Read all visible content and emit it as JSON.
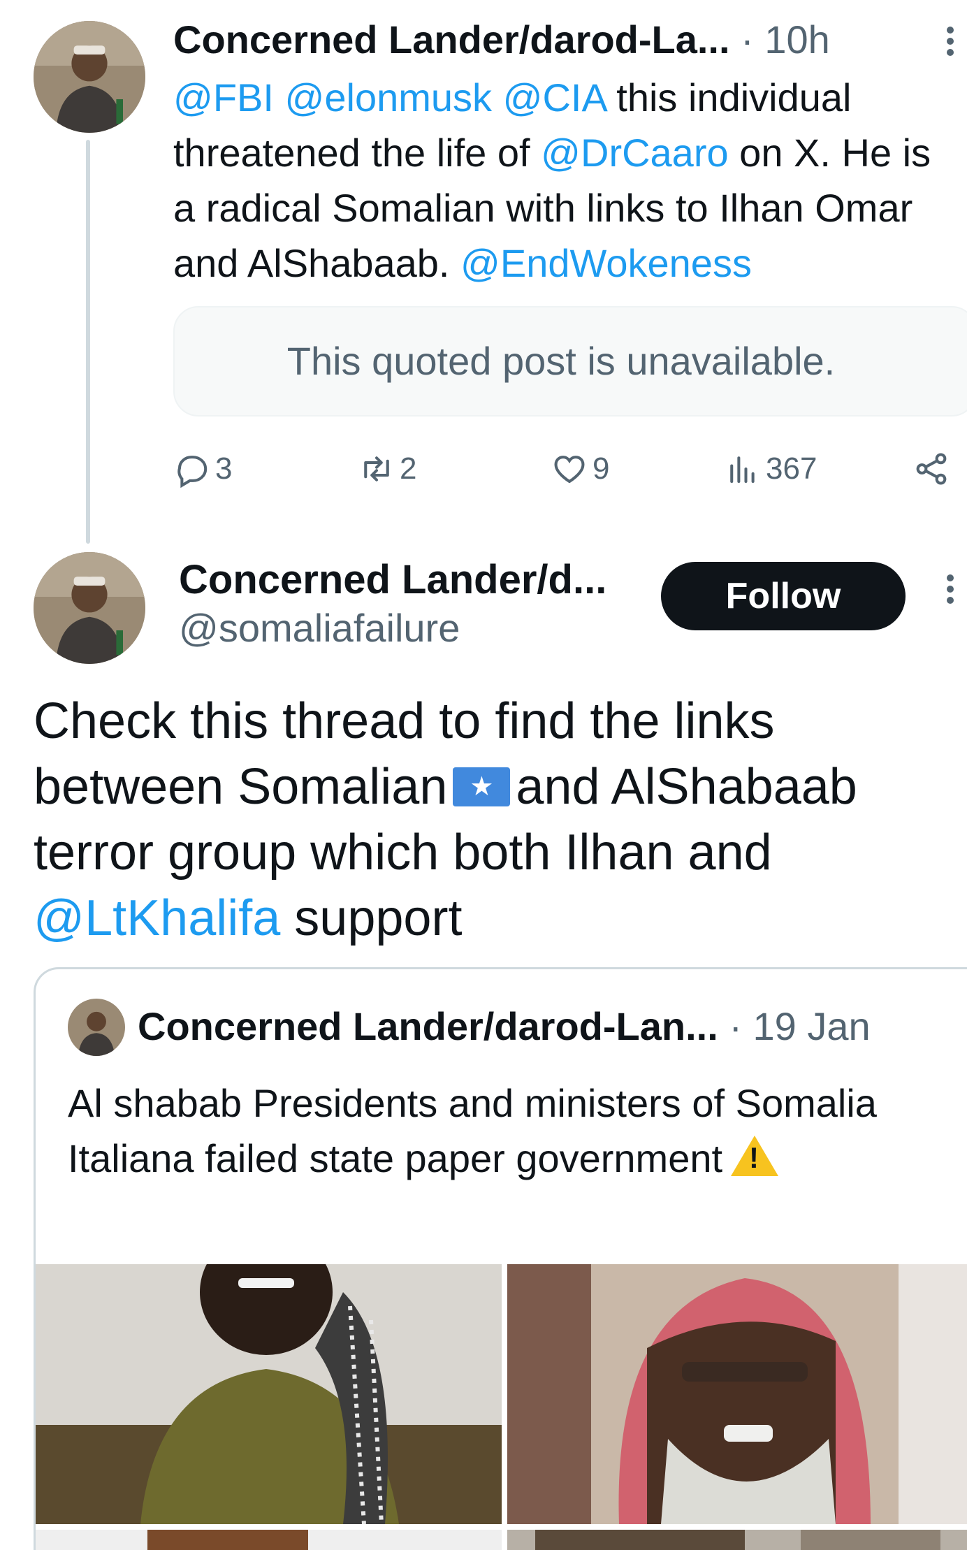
{
  "first_tweet": {
    "author_name": "Concerned Lander/darod-La...",
    "meta": "· 10h",
    "body_segments": [
      {
        "text": "@FBI",
        "link": true
      },
      {
        "text": " ",
        "link": false
      },
      {
        "text": "@elonmusk",
        "link": true
      },
      {
        "text": " ",
        "link": false
      },
      {
        "text": "@CIA",
        "link": true
      },
      {
        "text": " this individual threatened the life of ",
        "link": false
      },
      {
        "text": "@DrCaaro",
        "link": true
      },
      {
        "text": " on X. He is a radical Somalian with links to Ilhan Omar and AlShabaab. ",
        "link": false
      },
      {
        "text": "@EndWokeness",
        "link": true
      }
    ],
    "quoted_unavailable": "This quoted post is unavailable.",
    "actions": {
      "replies": "3",
      "reposts": "2",
      "likes": "9",
      "views": "367"
    }
  },
  "main_tweet": {
    "author_name": "Concerned Lander/d...",
    "handle": "@somaliafailure",
    "follow_label": "Follow",
    "body_segments": [
      {
        "text": "Check this thread to find the links between Somalian",
        "link": false
      },
      {
        "flag": true
      },
      {
        "text": "and AlShabaab terror group which both Ilhan and ",
        "link": false
      },
      {
        "text": "@LtKhalifa",
        "link": true
      },
      {
        "text": " support",
        "link": false
      }
    ]
  },
  "quoted_tweet": {
    "author_name": "Concerned Lander/darod-Lan...",
    "meta": "· 19 Jan",
    "body": "Al shabab Presidents and ministers of Somalia Italiana failed state paper government"
  },
  "colors": {
    "link": "#1d9bf0",
    "text": "#0f1419",
    "secondary": "#536471",
    "follow_button": "#0f1419"
  },
  "icons": {
    "reply": "speech-bubble-icon",
    "repost": "repost-arrows-icon",
    "like": "heart-icon",
    "views": "bar-chart-icon",
    "share": "share-nodes-icon",
    "more": "vertical-ellipsis-icon"
  }
}
